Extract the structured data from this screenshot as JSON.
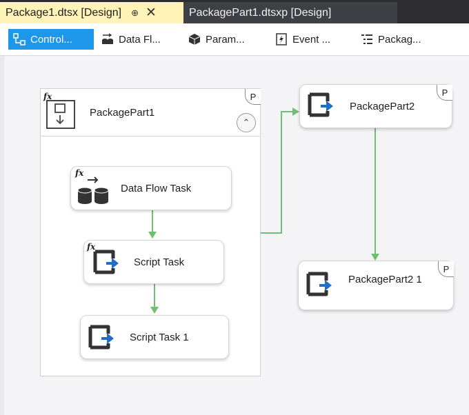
{
  "tabs": [
    {
      "label": "Package1.dtsx [Design]",
      "pin": "⊕",
      "close": "✕"
    },
    {
      "label": "PackagePart1.dtsxp [Design]"
    }
  ],
  "designer_tabs": [
    {
      "label": "Control...",
      "icon": "control-flow-icon"
    },
    {
      "label": "Data Fl...",
      "icon": "data-flow-icon"
    },
    {
      "label": "Param...",
      "icon": "parameters-icon"
    },
    {
      "label": "Event ...",
      "icon": "event-handlers-icon"
    },
    {
      "label": "Packag...",
      "icon": "package-explorer-icon"
    }
  ],
  "canvas": {
    "container": {
      "title": "PackagePart1",
      "fx": "fx",
      "badge": "P",
      "collapse": "⌃"
    },
    "tasks": [
      {
        "label": "Data Flow Task",
        "fx": "fx"
      },
      {
        "label": "Script Task",
        "fx": "fx"
      },
      {
        "label": "Script Task 1"
      }
    ],
    "parts": [
      {
        "label": "PackagePart2",
        "badge": "P"
      },
      {
        "label": "PackagePart2 1",
        "badge": "P"
      }
    ]
  },
  "colors": {
    "connector": "#6fbf73",
    "active_tab": "#fff3b8",
    "selected_subtab": "#1c97ea"
  }
}
